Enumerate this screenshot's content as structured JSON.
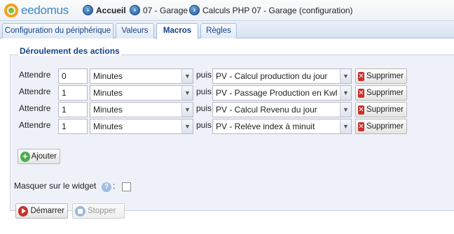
{
  "header": {
    "logo_text": "eedomus",
    "breadcrumbs": [
      {
        "label": "Accueil",
        "icon": "arrow-right-icon"
      },
      {
        "label": "07 - Garage",
        "icon": "arrow-right-icon"
      },
      {
        "label": "Calculs PHP 07 - Garage (configuration)",
        "icon": "arrow-right-icon"
      }
    ]
  },
  "tabs": [
    {
      "label": "Configuration du périphérique",
      "active": false
    },
    {
      "label": "Valeurs",
      "active": false
    },
    {
      "label": "Macros",
      "active": true
    },
    {
      "label": "Règles",
      "active": false
    }
  ],
  "section": {
    "legend": "Déroulement des actions",
    "wait_label": "Attendre",
    "then_label": "puis",
    "delete_label": "Supprimer",
    "add_label": "Ajouter",
    "actions": [
      {
        "delay": "0",
        "unit": "Minutes",
        "action": "PV - Calcul production du jour"
      },
      {
        "delay": "1",
        "unit": "Minutes",
        "action": "PV - Passage Production en Kwh"
      },
      {
        "delay": "1",
        "unit": "Minutes",
        "action": "PV - Calcul Revenu du jour"
      },
      {
        "delay": "1",
        "unit": "Minutes",
        "action": "PV - Relève index à minuit"
      }
    ]
  },
  "options": {
    "hide_widget_label": "Masquer sur le widget",
    "hide_widget_checked": false,
    "colon": ":"
  },
  "controls": {
    "start_label": "Démarrer",
    "stop_label": "Stopper"
  },
  "colors": {
    "accent": "#15428b",
    "panel_bg": "#eef2f8",
    "delete_red": "#c9302c",
    "add_green": "#4cae4c"
  }
}
